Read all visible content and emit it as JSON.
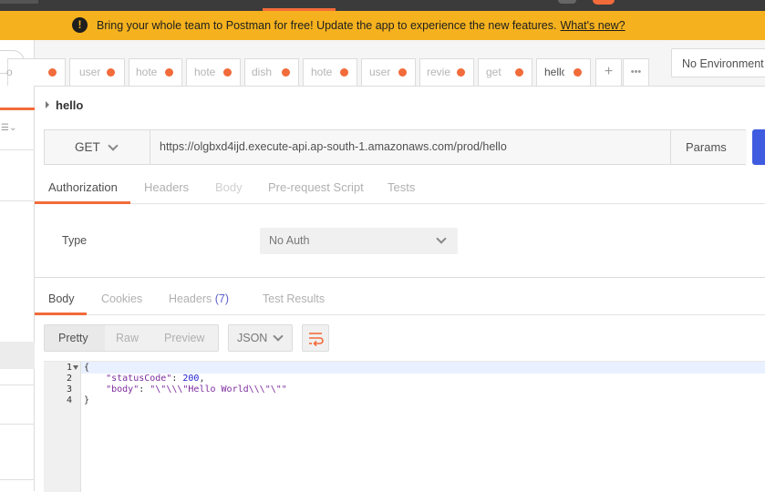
{
  "banner": {
    "message": "Bring your whole team to Postman for free! Update the app to experience the new features.",
    "link": "What's new?"
  },
  "tabs": [
    {
      "label": "o"
    },
    {
      "label": "user"
    },
    {
      "label": "hote"
    },
    {
      "label": "hote"
    },
    {
      "label": "dish"
    },
    {
      "label": "hote"
    },
    {
      "label": "user"
    },
    {
      "label": "revie"
    },
    {
      "label": "get"
    },
    {
      "label": "hello"
    }
  ],
  "tab_controls": {
    "add": "+",
    "more": "•••"
  },
  "environment": {
    "selected": "No Environment"
  },
  "request": {
    "name": "hello",
    "method": "GET",
    "url": "https://olgbxd4ijd.execute-api.ap-south-1.amazonaws.com/prod/hello",
    "params_label": "Params"
  },
  "request_tabs": [
    "Authorization",
    "Headers",
    "Body",
    "Pre-request Script",
    "Tests"
  ],
  "auth": {
    "type_label": "Type",
    "type_value": "No Auth"
  },
  "response_tabs": {
    "body": "Body",
    "cookies": "Cookies",
    "headers": "Headers",
    "headers_count": "(7)",
    "tests": "Test Results"
  },
  "view_modes": [
    "Pretty",
    "Raw",
    "Preview"
  ],
  "format": {
    "selected": "JSON"
  },
  "response_body": {
    "line_numbers": [
      "1",
      "2",
      "3",
      "4"
    ],
    "open_brace": "{",
    "status_key": "\"statusCode\"",
    "status_value": "200",
    "body_key": "\"body\"",
    "body_value": "\"\\\"\\\\\\\"Hello World\\\\\\\"\\\"\"",
    "close_brace": "}"
  },
  "colors": {
    "accent": "#f26b3a",
    "banner": "#f6b21e",
    "send": "#3f5ce0"
  }
}
